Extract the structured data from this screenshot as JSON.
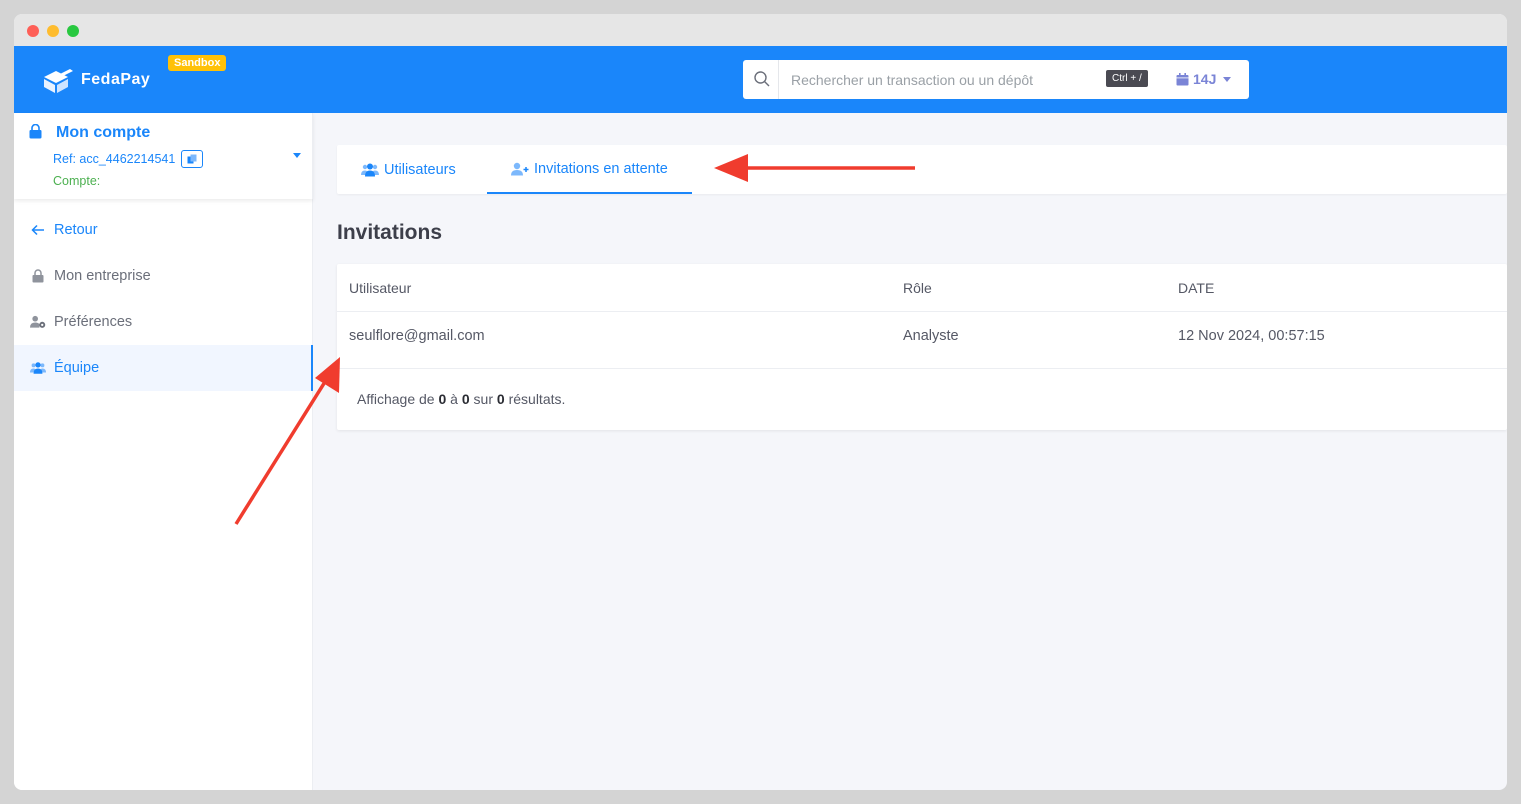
{
  "app": {
    "brand": "FedaPay",
    "env_badge": "Sandbox"
  },
  "search": {
    "placeholder": "Rechercher un transaction ou un dépôt",
    "shortcut": "Ctrl + /",
    "date_range": "14J"
  },
  "account": {
    "title": "Mon compte",
    "ref": "Ref: acc_4462214541",
    "compte_label": "Compte:"
  },
  "sidebar": {
    "items": [
      {
        "label": "Retour",
        "icon": "arrow-left-icon"
      },
      {
        "label": "Mon entreprise",
        "icon": "lock-icon"
      },
      {
        "label": "Préférences",
        "icon": "user-gear-icon"
      },
      {
        "label": "Équipe",
        "icon": "users-icon"
      }
    ]
  },
  "tabs": [
    {
      "label": "Utilisateurs"
    },
    {
      "label": "Invitations en attente"
    }
  ],
  "main": {
    "title": "Invitations",
    "columns": [
      "Utilisateur",
      "Rôle",
      "DATE"
    ],
    "rows": [
      {
        "user": "seulflore@gmail.com",
        "role": "Analyste",
        "date": "12 Nov 2024, 00:57:15"
      }
    ],
    "footer": {
      "prefix": "Affichage de",
      "from": "0",
      "mid1": "à",
      "to": "0",
      "mid2": "sur",
      "total": "0",
      "suffix": "résultats."
    }
  },
  "colors": {
    "primary": "#1a86fa",
    "badge": "#ffc107",
    "annotation": "#f03c2e",
    "success": "#4cb050"
  }
}
